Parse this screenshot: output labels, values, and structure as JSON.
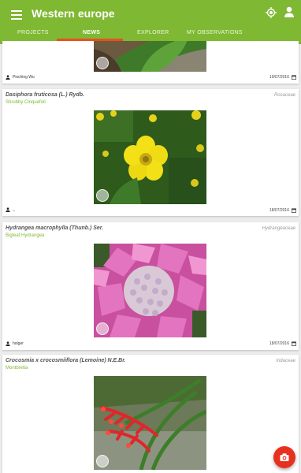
{
  "appbar": {
    "title": "Western europe"
  },
  "tabs": [
    {
      "label": "PROJECTS"
    },
    {
      "label": "NEWS"
    },
    {
      "label": "EXPLORER"
    },
    {
      "label": "MY OBSERVATIONS"
    }
  ],
  "cards": [
    {
      "user": "Pisching Wu",
      "date": "19/07/2016"
    },
    {
      "scientific_name": "Dasiphora fruticosa (L.) Rydb.",
      "common_name": "Shrubby Cinquefoil",
      "family": "Rosaceae",
      "user": "_",
      "date": "18/07/2016"
    },
    {
      "scientific_name": "Hydrangea macrophylla (Thunb.) Ser.",
      "common_name": "Bigleaf Hydrangea",
      "family": "Hydrangeaceae",
      "user": "holger",
      "date": "18/07/2016"
    },
    {
      "scientific_name": "Crocosmia x crocosmiiflora (Lemoine) N.E.Br.",
      "common_name": "Montbretia",
      "family": "Iridaceae"
    }
  ],
  "colors": {
    "primary": "#7fb832",
    "accent": "#e8501f",
    "fab": "#e8301f"
  }
}
